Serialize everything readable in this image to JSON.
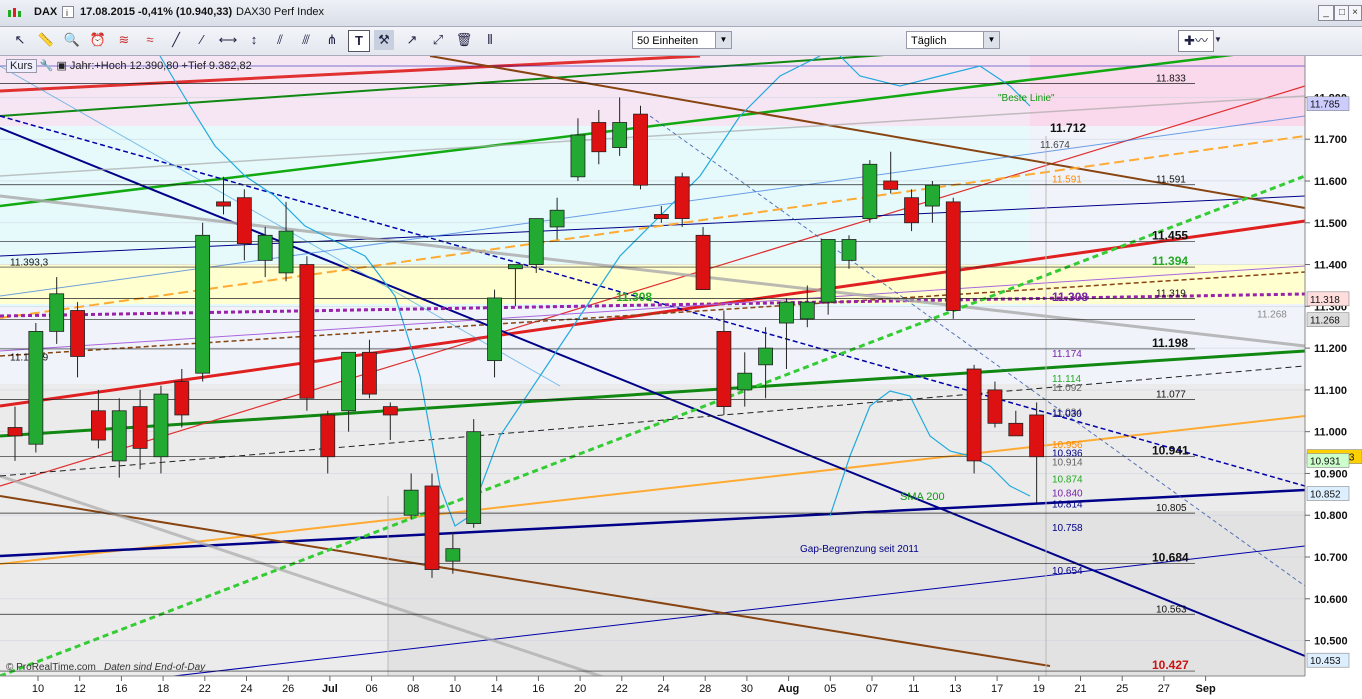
{
  "window": {
    "symbol": "DAX",
    "date": "17.08.2015",
    "change": "-0,41% (10.940,33)",
    "name": "DAX30 Perf Index"
  },
  "toolbar": {
    "units_select": "50 Einheiten",
    "period_select": "Täglich"
  },
  "info": {
    "label": "Kurs",
    "range_text": "Jahr:+Hoch 12.390,80 +Tief 9.382,82"
  },
  "footer": {
    "credit": "© ProRealTime.com",
    "note": "Daten sind End-of-Day"
  },
  "annotations": {
    "best_line": "\"Beste Linie\"",
    "sma200": "SMA 200",
    "gap": "Gap-Begrenzung seit 2011"
  },
  "colors": {
    "up": "#22aa33",
    "down": "#dd1111",
    "price_box": "#ffd000"
  },
  "chart_data": {
    "type": "candlestick",
    "title": "DAX30 Perf Index",
    "xlabel": "",
    "ylabel": "",
    "ylim": [
      10420,
      11880
    ],
    "x_ticks": [
      "10",
      "12",
      "16",
      "18",
      "22",
      "24",
      "26",
      "Jul",
      "06",
      "08",
      "10",
      "14",
      "16",
      "20",
      "22",
      "24",
      "28",
      "30",
      "Aug",
      "05",
      "07",
      "11",
      "13",
      "17",
      "19",
      "21",
      "25",
      "27",
      "Sep"
    ],
    "y_ticks": [
      "11.800",
      "11.700",
      "11.600",
      "11.500",
      "11.400",
      "11.300",
      "11.200",
      "11.100",
      "11.000",
      "10.900",
      "10.800",
      "10.700",
      "10.600",
      "10.500"
    ],
    "candles": [
      {
        "o": 11010,
        "h": 11060,
        "l": 10930,
        "c": 10990
      },
      {
        "o": 10970,
        "h": 11260,
        "l": 10950,
        "c": 11240
      },
      {
        "o": 11240,
        "h": 11370,
        "l": 11210,
        "c": 11330
      },
      {
        "o": 11290,
        "h": 11310,
        "l": 11130,
        "c": 11180
      },
      {
        "o": 11050,
        "h": 11100,
        "l": 10960,
        "c": 10980
      },
      {
        "o": 10930,
        "h": 11080,
        "l": 10890,
        "c": 11050
      },
      {
        "o": 11060,
        "h": 11100,
        "l": 10910,
        "c": 10960
      },
      {
        "o": 10940,
        "h": 11110,
        "l": 10900,
        "c": 11090
      },
      {
        "o": 11120,
        "h": 11150,
        "l": 11010,
        "c": 11040
      },
      {
        "o": 11140,
        "h": 11500,
        "l": 11120,
        "c": 11470
      },
      {
        "o": 11550,
        "h": 11610,
        "l": 11520,
        "c": 11540
      },
      {
        "o": 11560,
        "h": 11580,
        "l": 11410,
        "c": 11450
      },
      {
        "o": 11410,
        "h": 11490,
        "l": 11370,
        "c": 11470
      },
      {
        "o": 11380,
        "h": 11550,
        "l": 11360,
        "c": 11480
      },
      {
        "o": 11400,
        "h": 11420,
        "l": 11050,
        "c": 11080
      },
      {
        "o": 11040,
        "h": 11050,
        "l": 10900,
        "c": 10940
      },
      {
        "o": 11050,
        "h": 11190,
        "l": 11000,
        "c": 11190
      },
      {
        "o": 11190,
        "h": 11220,
        "l": 11080,
        "c": 11090
      },
      {
        "o": 11060,
        "h": 11070,
        "l": 10980,
        "c": 11040
      },
      {
        "o": 10800,
        "h": 10900,
        "l": 10790,
        "c": 10860
      },
      {
        "o": 10870,
        "h": 10900,
        "l": 10650,
        "c": 10670
      },
      {
        "o": 10690,
        "h": 10760,
        "l": 10660,
        "c": 10720
      },
      {
        "o": 10780,
        "h": 11030,
        "l": 10770,
        "c": 11000
      },
      {
        "o": 11170,
        "h": 11340,
        "l": 11130,
        "c": 11320
      },
      {
        "o": 11390,
        "h": 11400,
        "l": 11300,
        "c": 11400
      },
      {
        "o": 11400,
        "h": 11490,
        "l": 11380,
        "c": 11510
      },
      {
        "o": 11490,
        "h": 11560,
        "l": 11460,
        "c": 11530
      },
      {
        "o": 11610,
        "h": 11750,
        "l": 11600,
        "c": 11710
      },
      {
        "o": 11740,
        "h": 11770,
        "l": 11640,
        "c": 11670
      },
      {
        "o": 11680,
        "h": 11800,
        "l": 11660,
        "c": 11740
      },
      {
        "o": 11760,
        "h": 11780,
        "l": 11580,
        "c": 11590
      },
      {
        "o": 11520,
        "h": 11540,
        "l": 11500,
        "c": 11510
      },
      {
        "o": 11610,
        "h": 11620,
        "l": 11490,
        "c": 11510
      },
      {
        "o": 11470,
        "h": 11490,
        "l": 11340,
        "c": 11340
      },
      {
        "o": 11240,
        "h": 11290,
        "l": 11040,
        "c": 11060
      },
      {
        "o": 11100,
        "h": 11190,
        "l": 11060,
        "c": 11140
      },
      {
        "o": 11160,
        "h": 11250,
        "l": 11080,
        "c": 11200
      },
      {
        "o": 11260,
        "h": 11320,
        "l": 11150,
        "c": 11310
      },
      {
        "o": 11270,
        "h": 11350,
        "l": 11250,
        "c": 11310
      },
      {
        "o": 11310,
        "h": 11460,
        "l": 11280,
        "c": 11460
      },
      {
        "o": 11410,
        "h": 11470,
        "l": 11390,
        "c": 11460
      },
      {
        "o": 11510,
        "h": 11650,
        "l": 11500,
        "c": 11640
      },
      {
        "o": 11600,
        "h": 11670,
        "l": 11570,
        "c": 11580
      },
      {
        "o": 11560,
        "h": 11580,
        "l": 11480,
        "c": 11500
      },
      {
        "o": 11540,
        "h": 11600,
        "l": 11500,
        "c": 11590
      },
      {
        "o": 11550,
        "h": 11560,
        "l": 11270,
        "c": 11290
      },
      {
        "o": 11150,
        "h": 11160,
        "l": 10900,
        "c": 10930
      },
      {
        "o": 11100,
        "h": 11120,
        "l": 11010,
        "c": 11020
      },
      {
        "o": 11020,
        "h": 11050,
        "l": 10990,
        "c": 10990
      },
      {
        "o": 11040,
        "h": 11070,
        "l": 10830,
        "c": 10940
      }
    ],
    "level_labels": [
      {
        "value": 11833,
        "label": "11.833"
      },
      {
        "value": 11712,
        "label": "11.712"
      },
      {
        "value": 11674,
        "label": "11.674"
      },
      {
        "value": 11591,
        "label": "11.591"
      },
      {
        "value": 11591,
        "label": "11.591"
      },
      {
        "value": 11455,
        "label": "11.455"
      },
      {
        "value": 11394,
        "label": "11.394"
      },
      {
        "value": 11393,
        "label": "11.393,3"
      },
      {
        "value": 11319,
        "label": "11.319"
      },
      {
        "value": 11308,
        "label": "11.308"
      },
      {
        "value": 11308,
        "label": "11.308"
      },
      {
        "value": 11268,
        "label": "11.268"
      },
      {
        "value": 11198,
        "label": "11.198"
      },
      {
        "value": 11174,
        "label": "11.174"
      },
      {
        "value": 11165,
        "label": "11.164,9"
      },
      {
        "value": 11114,
        "label": "11.114"
      },
      {
        "value": 11092,
        "label": "11.092"
      },
      {
        "value": 11077,
        "label": "11.077"
      },
      {
        "value": 11034,
        "label": "11.034"
      },
      {
        "value": 11030,
        "label": "11.030"
      },
      {
        "value": 10956,
        "label": "10.956"
      },
      {
        "value": 10941,
        "label": "10.941"
      },
      {
        "value": 10936,
        "label": "10.936"
      },
      {
        "value": 10914,
        "label": "10.914"
      },
      {
        "value": 10874,
        "label": "10.874"
      },
      {
        "value": 10840,
        "label": "10.840"
      },
      {
        "value": 10814,
        "label": "10.814"
      },
      {
        "value": 10805,
        "label": "10.805"
      },
      {
        "value": 10758,
        "label": "10.758"
      },
      {
        "value": 10684,
        "label": "10.684"
      },
      {
        "value": 10654,
        "label": "10.654"
      },
      {
        "value": 10563,
        "label": "10.563"
      },
      {
        "value": 10427,
        "label": "10.427"
      }
    ],
    "axis_boxes": [
      {
        "value": 11785,
        "label": "11.785"
      },
      {
        "value": 11318,
        "label": "11.318"
      },
      {
        "value": 11268,
        "label": "11.268"
      },
      {
        "value": 10940.33,
        "label": "10.940,33"
      },
      {
        "value": 10931,
        "label": "10.931"
      },
      {
        "value": 10852,
        "label": "10.852"
      },
      {
        "value": 10453,
        "label": "10.453"
      }
    ]
  }
}
